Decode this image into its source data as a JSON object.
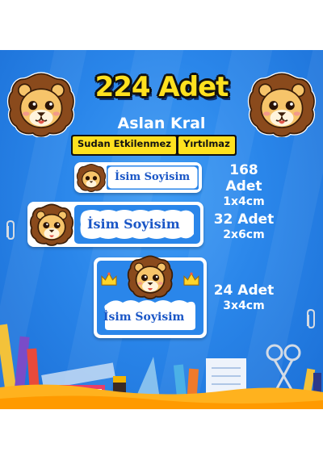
{
  "header": {
    "title": "224 Adet",
    "subtitle": "Aslan Kral"
  },
  "features": [
    "Sudan Etkilenmez",
    "Yırtılmaz"
  ],
  "labels": [
    {
      "name": "İsim Soyisim",
      "count": "168 Adet",
      "size": "1x4cm"
    },
    {
      "name": "İsim Soyisim",
      "count": "32 Adet",
      "size": "2x6cm"
    },
    {
      "name": "İsim Soyisim",
      "count": "24 Adet",
      "size": "3x4cm"
    }
  ],
  "colors": {
    "background": "#2a86ea",
    "title": "#ffe11f",
    "name_text": "#1a56c6",
    "lion_mane": "#8a4a1c",
    "lion_face": "#f6c46a"
  },
  "icons": [
    "lion-mascot-icon",
    "crown-icon",
    "pencil-icon",
    "paperclip-icon",
    "scissors-icon",
    "ruler-icon",
    "notebook-icon"
  ]
}
